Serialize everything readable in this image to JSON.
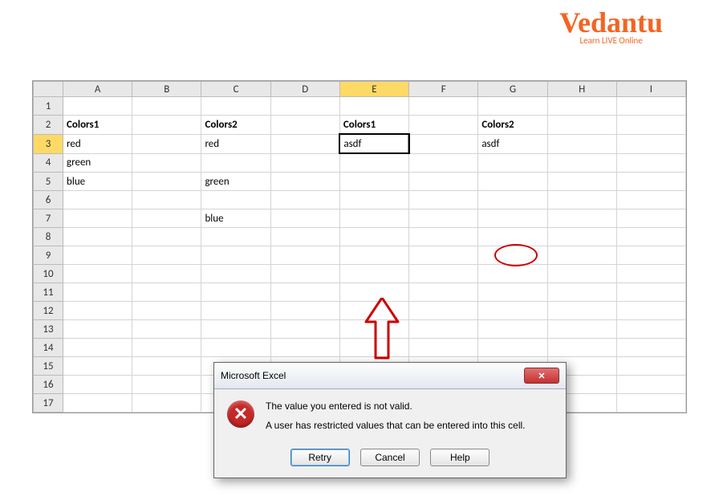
{
  "logo": {
    "main": "Vedantu",
    "sub": "Learn LIVE Online"
  },
  "columns": [
    "",
    "A",
    "B",
    "C",
    "D",
    "E",
    "F",
    "G",
    "H",
    "I"
  ],
  "rows": 17,
  "cells": {
    "A2": "Colors1",
    "C2": "Colors2",
    "E2": "Colors1",
    "G2": "Colors2",
    "A3": "red",
    "C3": "red",
    "E3": "asdf",
    "G3": "asdf",
    "A4": "green",
    "A5": "blue",
    "C5": "green",
    "C7": "blue"
  },
  "bold_cells": [
    "A2",
    "C2",
    "E2",
    "G2"
  ],
  "active_col": "E",
  "active_row": 3,
  "selected_cell": "E3",
  "dialog": {
    "title": "Microsoft Excel",
    "line1": "The value you entered is not valid.",
    "line2": "A user has restricted values that can be entered into this cell.",
    "retry": "Retry",
    "cancel": "Cancel",
    "help": "Help"
  }
}
